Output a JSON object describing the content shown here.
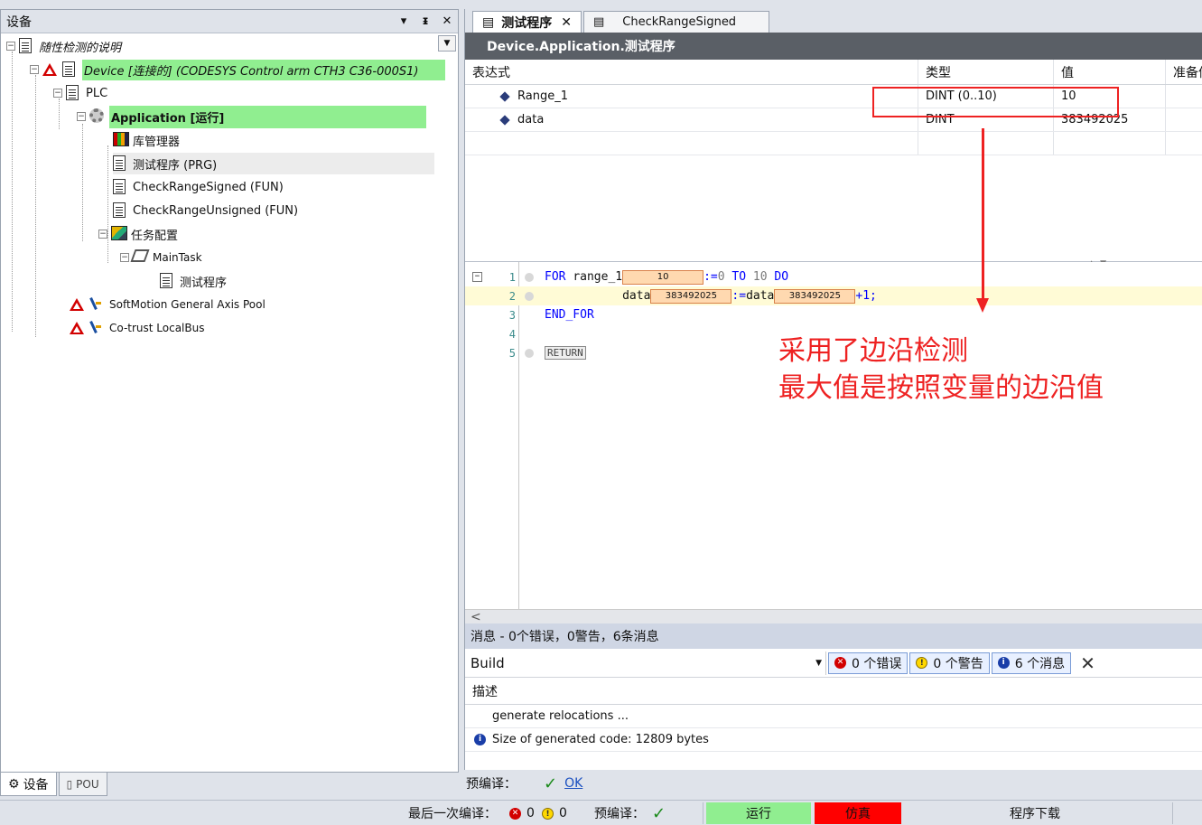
{
  "device_panel": {
    "title": "设备",
    "header_buttons": [
      "▾",
      "ᵻ",
      "✕"
    ],
    "tree": {
      "root": "随性检测的说明",
      "device": "Device [连接的] (CODESYS Control arm CTH3 C36-000S1)",
      "plc": "PLC",
      "application": "Application [运行]",
      "library_manager": "库管理器",
      "test_program": "测试程序 (PRG)",
      "check_range_signed": "CheckRangeSigned (FUN)",
      "check_range_unsigned": "CheckRangeUnsigned (FUN)",
      "task_config": "任务配置",
      "main_task": "MainTask",
      "task_program": "测试程序",
      "softmotion": "SoftMotion General Axis Pool",
      "localbus": "Co-trust LocalBus"
    },
    "bottom_tabs": [
      "设备",
      "POU"
    ]
  },
  "editor": {
    "tabs": [
      {
        "label": "测试程序",
        "close": "✕"
      },
      {
        "label": "CheckRangeSigned"
      }
    ],
    "path": "Device.Application.测试程序",
    "watch_columns": [
      "表达式",
      "类型",
      "值",
      "准备值"
    ],
    "watch_rows": [
      {
        "expression": "Range_1",
        "type": "DINT (0..10)",
        "value": "10"
      },
      {
        "expression": "data",
        "type": "DINT",
        "value": "383492025"
      }
    ],
    "code_lines": [
      {
        "num": "1",
        "tokens": {
          "kw1": "FOR",
          "var": "range_1",
          "inline": "10",
          "op": ":=",
          "n1": "0",
          "kw2": "TO",
          "n2": "10",
          "kw3": "DO"
        }
      },
      {
        "num": "2",
        "tokens": {
          "var": "data",
          "inline": "383492025",
          "op": ":=",
          "var2": "data",
          "inline2": "383492025",
          "tail": "+1;"
        }
      },
      {
        "num": "3",
        "tokens": {
          "kw": "END_FOR"
        }
      },
      {
        "num": "4"
      },
      {
        "num": "5",
        "tokens": {
          "ret": "RETURN"
        }
      }
    ],
    "scroll_left": "<"
  },
  "annotation": {
    "line1": "采用了边沿检测",
    "line2": "最大值是按照变量的边沿值",
    "color": "#ee2222"
  },
  "messages": {
    "title": "消息 - 0个错误，0警告，6条消息",
    "source": "Build",
    "errors_btn": "0 个错误",
    "warnings_btn": "0 个警告",
    "info_btn": "6 个消息",
    "column": "描述",
    "rows": [
      "generate relocations ...",
      "Size of generated code: 12809 bytes"
    ]
  },
  "precompile": {
    "label": "预编译：",
    "status": "OK"
  },
  "statusbar": {
    "last_build": "最后一次编译：",
    "errors": "0",
    "warnings": "0",
    "precompile": "预编译：",
    "run": "运行",
    "sim": "仿真",
    "download": "程序下载"
  }
}
